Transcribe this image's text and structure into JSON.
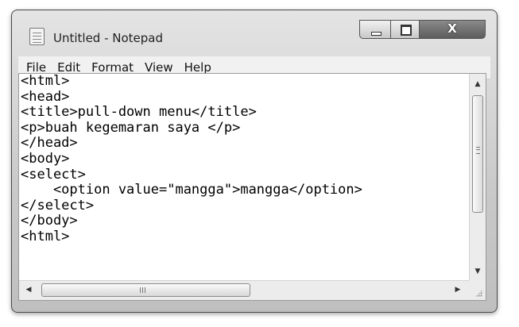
{
  "window": {
    "title": "Untitled - Notepad",
    "close_glyph": "X"
  },
  "menu": {
    "items": [
      "File",
      "Edit",
      "Format",
      "View",
      "Help"
    ]
  },
  "editor": {
    "lines": [
      "<html>",
      "<head>",
      "<title>pull-down menu</title>",
      "<p>buah kegemaran saya </p>",
      "</head>",
      "<body>",
      "<select>",
      "    <option value=\"mangga\">mangga</option>",
      "</select>",
      "</body>",
      "<html>"
    ]
  },
  "icons": {
    "app": "notepad-icon",
    "minimize": "minimize-icon",
    "maximize": "maximize-icon",
    "close": "close-icon"
  }
}
